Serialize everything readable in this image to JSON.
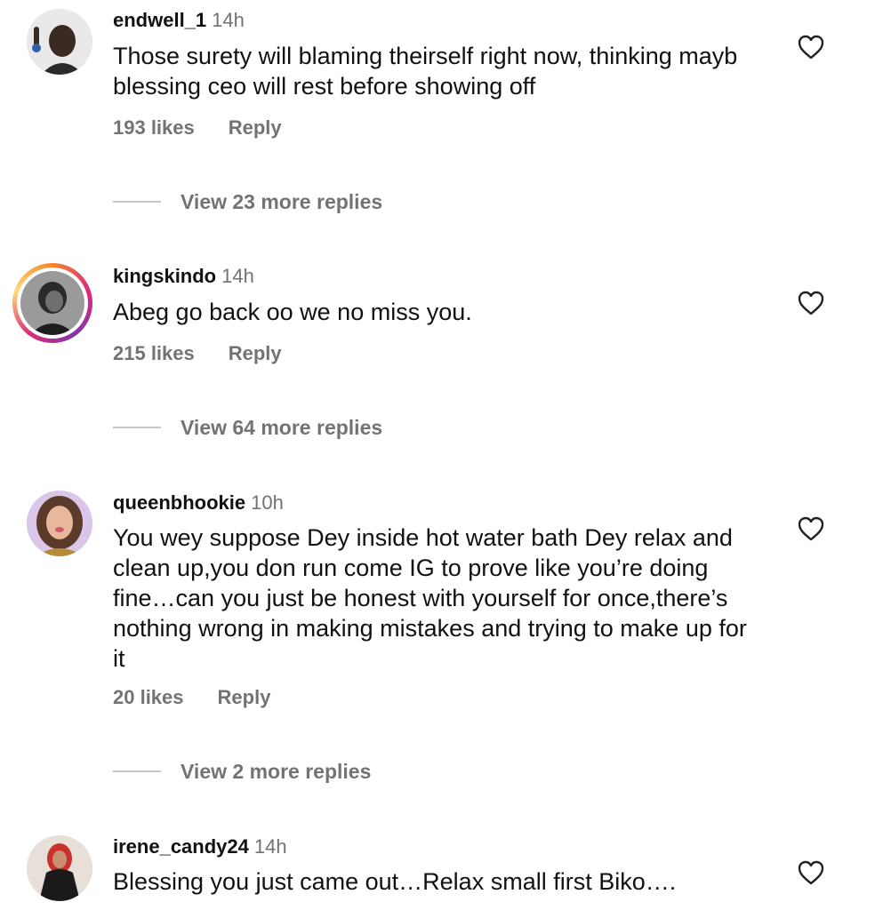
{
  "comments": [
    {
      "username": "endwell_1",
      "time": "14h",
      "text": "Those surety will blaming theirself right now, thinking mayb blessing ceo will rest before showing off",
      "likes": "193 likes",
      "reply": "Reply",
      "view_more": "View 23 more replies"
    },
    {
      "username": "kingskindo",
      "time": "14h",
      "text": "Abeg go back oo we no miss you.",
      "likes": "215 likes",
      "reply": "Reply",
      "view_more": "View 64 more replies"
    },
    {
      "username": "queenbhookie",
      "time": "10h",
      "text": "You wey suppose Dey inside hot water bath Dey relax and clean up,you don run come IG to prove like you’re doing fine…can you just be honest with yourself for once,there’s nothing wrong in making mistakes and trying to make up for it",
      "likes": "20 likes",
      "reply": "Reply",
      "view_more": "View 2 more replies"
    },
    {
      "username": "irene_candy24",
      "time": "14h",
      "text": "Blessing you just came out…Relax small first Biko…."
    }
  ],
  "icons": {
    "like": "heart-outline-icon",
    "story_ring": "gradient-story-ring"
  },
  "colors": {
    "text": "#111111",
    "secondary": "#737373",
    "divider": "#c7c7c7",
    "story_ring_start": "#f58529",
    "story_ring_end": "#dd2a7b"
  }
}
